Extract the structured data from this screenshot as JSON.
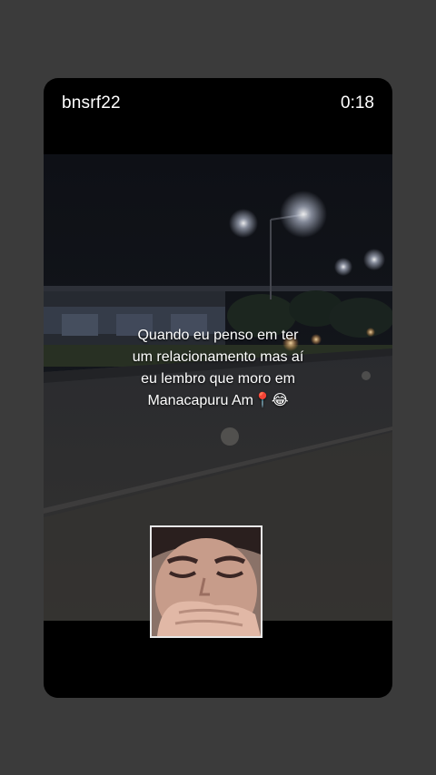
{
  "post": {
    "username": "bnsrf22",
    "timer": "0:18"
  },
  "caption": {
    "lines": [
      "Quando eu penso em ter",
      "um relacionamento mas aí",
      "eu lembro que moro em",
      "Manacapuru Am📍😂"
    ]
  },
  "colors": {
    "page_background": "#3b3b3b",
    "card_background": "#000000",
    "text": "#ffffff"
  },
  "icons": {
    "pin": "round-pushpin-icon",
    "laugh": "face-with-tears-of-joy-icon"
  }
}
